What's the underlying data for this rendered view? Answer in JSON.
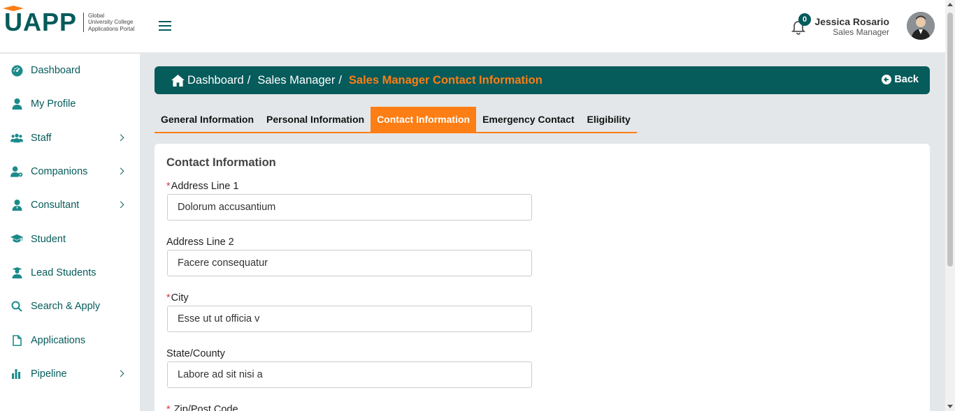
{
  "header": {
    "logo_text": "UAPP",
    "logo_subtitle": [
      "Global",
      "University College",
      "Applications Portal"
    ],
    "notification_count": "0",
    "user_name": "Jessica Rosario",
    "user_role": "Sales Manager"
  },
  "sidebar": {
    "items": [
      {
        "label": "Dashboard",
        "icon": "dashboard-icon",
        "has_submenu": false
      },
      {
        "label": "My Profile",
        "icon": "user-icon",
        "has_submenu": false
      },
      {
        "label": "Staff",
        "icon": "users-icon",
        "has_submenu": true
      },
      {
        "label": "Companions",
        "icon": "companions-icon",
        "has_submenu": true
      },
      {
        "label": "Consultant",
        "icon": "consultant-icon",
        "has_submenu": true
      },
      {
        "label": "Student",
        "icon": "graduation-cap-icon",
        "has_submenu": false
      },
      {
        "label": "Lead Students",
        "icon": "lead-student-icon",
        "has_submenu": false
      },
      {
        "label": "Search & Apply",
        "icon": "search-icon",
        "has_submenu": false
      },
      {
        "label": "Applications",
        "icon": "document-icon",
        "has_submenu": false
      },
      {
        "label": "Pipeline",
        "icon": "bar-chart-icon",
        "has_submenu": true
      }
    ]
  },
  "breadcrumb": {
    "items": [
      "Dashboard",
      "Sales Manager"
    ],
    "separator": "/",
    "current": "Sales Manager Contact Information",
    "back_label": "Back"
  },
  "tabs": [
    {
      "label": "General Information",
      "active": false
    },
    {
      "label": "Personal Information",
      "active": false
    },
    {
      "label": "Contact Information",
      "active": true
    },
    {
      "label": "Emergency Contact",
      "active": false
    },
    {
      "label": "Eligibility",
      "active": false
    }
  ],
  "form": {
    "title": "Contact Information",
    "required_marker": "*",
    "fields": [
      {
        "label": "Address Line 1",
        "required": true,
        "value": "Dolorum accusantium"
      },
      {
        "label": "Address Line 2",
        "required": false,
        "value": "Facere consequatur"
      },
      {
        "label": "City",
        "required": true,
        "value": "Esse ut ut officia v"
      },
      {
        "label": "State/County",
        "required": false,
        "value": "Labore ad sit nisi a"
      },
      {
        "label": "Zip/Post Code",
        "required": true,
        "value": ""
      }
    ]
  },
  "colors": {
    "brand_teal": "#065b5b",
    "accent_orange": "#fd7e14",
    "required_red": "#dc3545"
  }
}
